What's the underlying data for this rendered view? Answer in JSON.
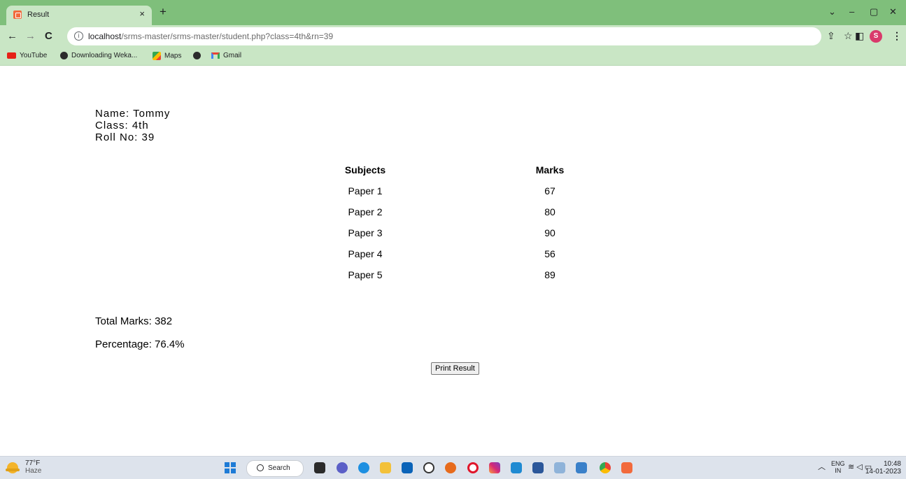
{
  "browser": {
    "tab_title": "Result",
    "tab_close": "×",
    "new_tab": "+",
    "url_host": "localhost",
    "url_path": "/srms-master/srms-master/student.php?class=4th&rn=39",
    "window_controls": [
      "⌄",
      "–",
      "▢",
      "✕"
    ],
    "bookmarks": [
      {
        "label": "YouTube",
        "icon": "youtube-icon"
      },
      {
        "label": "Downloading Weka...",
        "icon": "globe-icon"
      },
      {
        "label": "Maps",
        "icon": "maps-icon"
      },
      {
        "label": "",
        "icon": "globe-icon"
      },
      {
        "label": "Gmail",
        "icon": "gmail-icon"
      }
    ],
    "profile_initial": "S"
  },
  "student": {
    "name_line": "Name: Tommy",
    "class_line": "Class: 4th",
    "roll_line": "Roll No: 39"
  },
  "results": {
    "headers": [
      "Subjects",
      "Marks"
    ],
    "rows": [
      {
        "subject": "Paper 1",
        "marks": "67"
      },
      {
        "subject": "Paper 2",
        "marks": "80"
      },
      {
        "subject": "Paper 3",
        "marks": "90"
      },
      {
        "subject": "Paper 4",
        "marks": "56"
      },
      {
        "subject": "Paper 5",
        "marks": "89"
      }
    ],
    "total": "Total Marks: 382",
    "percentage": "Percentage: 76.4%",
    "print_label": "Print Result"
  },
  "taskbar": {
    "temperature": "77°F",
    "weather": "Haze",
    "search_label": "Search",
    "lang_top": "ENG",
    "lang_bottom": "IN",
    "time": "10:48",
    "date": "14-01-2023"
  },
  "colors": {
    "tabstrip": "#7fbf7b",
    "toolbar": "#c9e6c5",
    "taskbar": "#dde3ec"
  }
}
